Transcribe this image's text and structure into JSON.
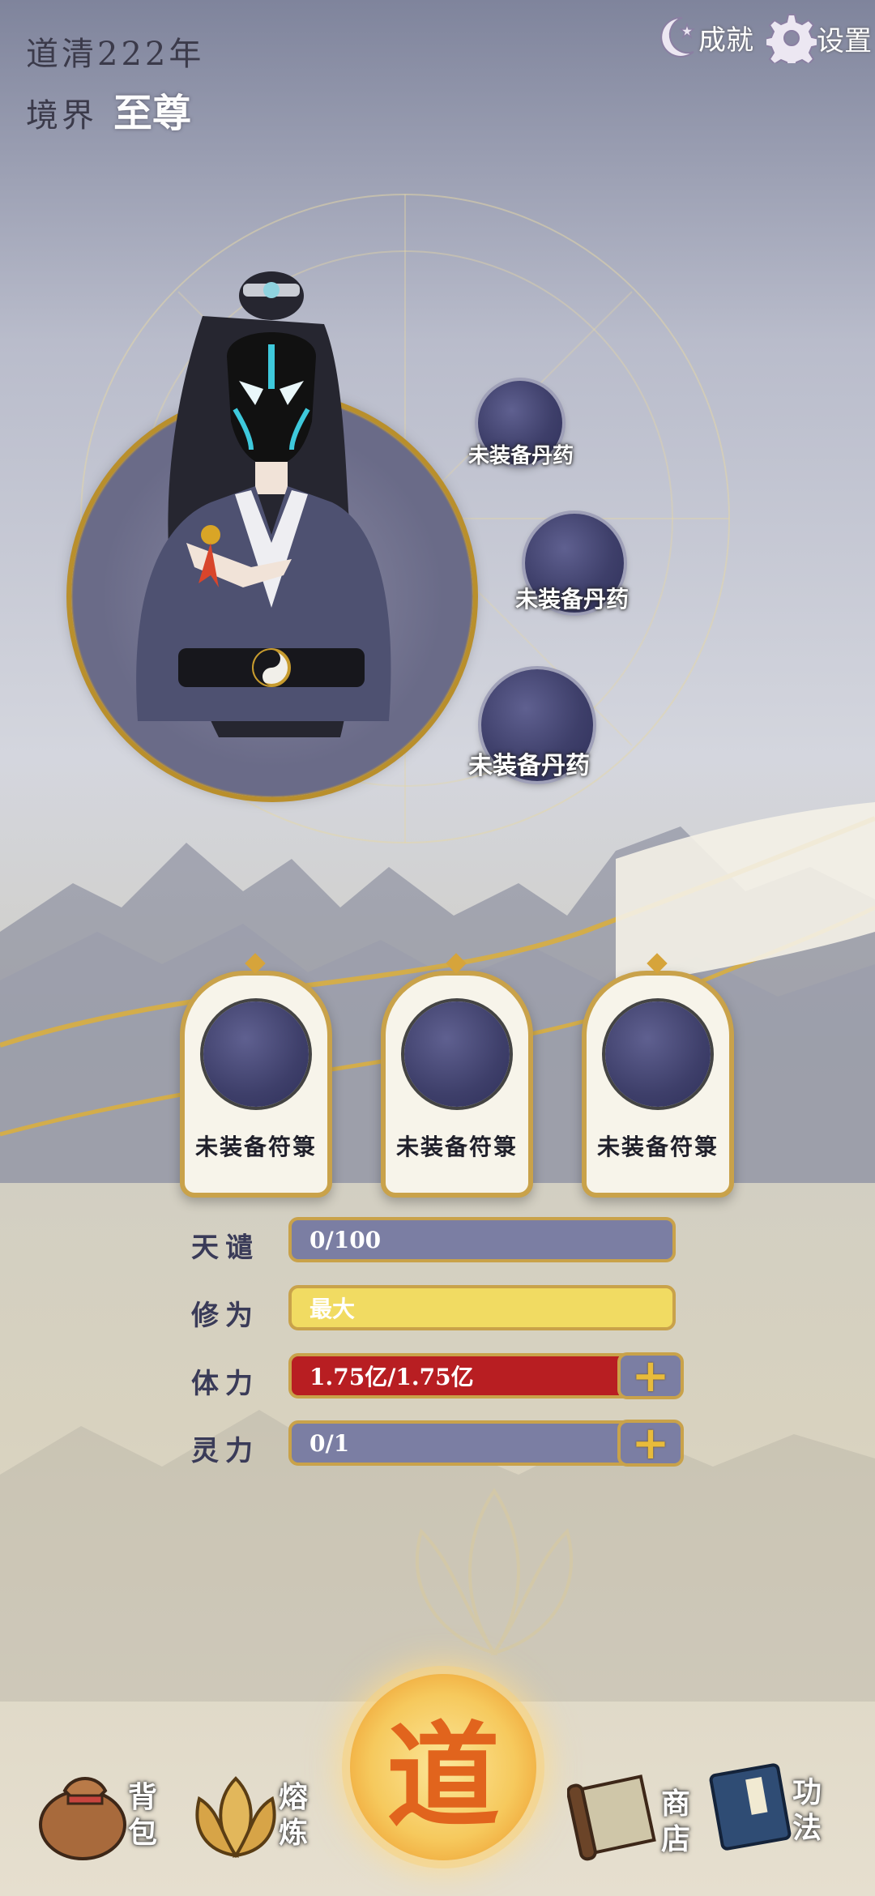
{
  "header": {
    "year": "道清222年",
    "realm_label": "境界",
    "realm_value": "至尊",
    "achievements_label": "成就",
    "settings_label": "设置"
  },
  "pill_slots": [
    {
      "label": "未装备丹药"
    },
    {
      "label": "未装备丹药"
    },
    {
      "label": "未装备丹药"
    }
  ],
  "talisman_slots": [
    {
      "label": "未装备符箓"
    },
    {
      "label": "未装备符箓"
    },
    {
      "label": "未装备符箓"
    }
  ],
  "stats": {
    "tianqian": {
      "label": "天谴",
      "value": "0/100"
    },
    "xiuwei": {
      "label": "修为",
      "value": "最大"
    },
    "tili": {
      "label": "体力",
      "value": "1.75亿/1.75亿"
    },
    "lingli": {
      "label": "灵力",
      "value": "0/1"
    }
  },
  "bottom_nav": {
    "bag": "背包",
    "refine": "熔炼",
    "center": "道",
    "shop": "商店",
    "skills": "功法"
  },
  "colors": {
    "gold": "#c9a24a",
    "bar_grey": "#7b7ea3",
    "bar_yellow": "#f1db62",
    "bar_red": "#b81e22"
  }
}
